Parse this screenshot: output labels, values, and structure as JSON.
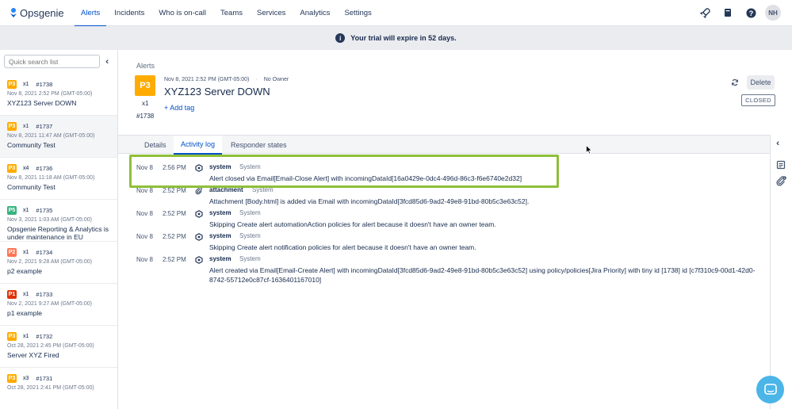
{
  "app": {
    "name": "Opsgenie"
  },
  "nav": {
    "items": [
      {
        "label": "Alerts",
        "active": true
      },
      {
        "label": "Incidents"
      },
      {
        "label": "Who is on-call"
      },
      {
        "label": "Teams"
      },
      {
        "label": "Services"
      },
      {
        "label": "Analytics"
      },
      {
        "label": "Settings"
      }
    ],
    "icons": [
      "rocket-icon",
      "book-icon",
      "help-icon"
    ],
    "avatar_initials": "NH"
  },
  "banner": {
    "text": "Your trial will expire in 52 days.",
    "icon": "info-icon"
  },
  "sidebar": {
    "search_placeholder": "Quick search list",
    "alerts": [
      {
        "priority": "P3",
        "color": "#ffab00",
        "count": "x1",
        "number": "#1738",
        "date": "Nov 8, 2021 2:52 PM (GMT-05:00)",
        "title": "XYZ123 Server DOWN",
        "selected": false
      },
      {
        "priority": "P3",
        "color": "#ffab00",
        "count": "x1",
        "number": "#1737",
        "date": "Nov 8, 2021 11:47 AM (GMT-05:00)",
        "title": "Community Test",
        "selected": true
      },
      {
        "priority": "P3",
        "color": "#ffab00",
        "count": "x4",
        "number": "#1736",
        "date": "Nov 8, 2021 11:18 AM (GMT-05:00)",
        "title": "Community Test",
        "selected": false
      },
      {
        "priority": "P5",
        "color": "#36b37e",
        "count": "x1",
        "number": "#1735",
        "date": "Nov 3, 2021 1:03 AM (GMT-05:00)",
        "title": "Opsgenie Reporting & Analytics is under maintenance in EU",
        "selected": false
      },
      {
        "priority": "P2",
        "color": "#ff7452",
        "count": "x1",
        "number": "#1734",
        "date": "Nov 2, 2021 9:28 AM (GMT-05:00)",
        "title": "p2 example",
        "selected": false
      },
      {
        "priority": "P1",
        "color": "#de350b",
        "count": "x1",
        "number": "#1733",
        "date": "Nov 2, 2021 9:27 AM (GMT-05:00)",
        "title": "p1 example",
        "selected": false
      },
      {
        "priority": "P3",
        "color": "#ffab00",
        "count": "x1",
        "number": "#1732",
        "date": "Oct 28, 2021 2:45 PM (GMT-05:00)",
        "title": "Server XYZ Fired",
        "selected": false
      },
      {
        "priority": "P3",
        "color": "#ffab00",
        "count": "x3",
        "number": "#1731",
        "date": "Oct 28, 2021 2:41 PM (GMT-05:00)",
        "title": "",
        "selected": false
      }
    ]
  },
  "detail": {
    "breadcrumb": "Alerts",
    "priority": "P3",
    "count": "x1",
    "number": "#1738",
    "datetime": "Nov 8, 2021 2:52 PM (GMT-05:00)",
    "owner": "No Owner",
    "title": "XYZ123 Server DOWN",
    "add_tag": "+ Add tag",
    "delete_label": "Delete",
    "status": "CLOSED",
    "tabs": [
      {
        "label": "Details"
      },
      {
        "label": "Activity log",
        "active": true
      },
      {
        "label": "Responder states"
      }
    ],
    "logs": [
      {
        "date": "Nov 8",
        "time": "2:56 PM",
        "user": "system",
        "source": "System",
        "message": "Alert closed via Email[Email-Close Alert] with incomingDataId[16a0429e-0dc4-496d-86c3-f6e6740e2d32]",
        "icon": "integration-icon"
      },
      {
        "date": "Nov 8",
        "time": "2:52 PM",
        "user": "attachment",
        "source": "System",
        "message": "Attachment [Body.html] is added via Email with incomingDataId[3fcd85d6-9ad2-49e8-91bd-80b5c3e63c52].",
        "icon": "paperclip-icon"
      },
      {
        "date": "Nov 8",
        "time": "2:52 PM",
        "user": "system",
        "source": "System",
        "message": "Skipping Create alert automationAction policies for alert because it doesn't have an owner team.",
        "icon": "integration-icon"
      },
      {
        "date": "Nov 8",
        "time": "2:52 PM",
        "user": "system",
        "source": "System",
        "message": "Skipping Create alert notification policies for alert because it doesn't have an owner team.",
        "icon": "integration-icon"
      },
      {
        "date": "Nov 8",
        "time": "2:52 PM",
        "user": "system",
        "source": "System",
        "message": "Alert created via Email[Email-Create Alert] with incomingDataId[3fcd85d6-9ad2-49e8-91bd-80b5c3e63c52] using policy/policies[Jira Priority] with tiny id [1738] id [c7f310c9-00d1-42d0-8742-55712e0c87cf-1636401167010]",
        "icon": "integration-icon"
      }
    ]
  },
  "colors": {
    "accent": "#0052cc",
    "highlight": "#8fbf3a",
    "p3": "#ffab00"
  }
}
